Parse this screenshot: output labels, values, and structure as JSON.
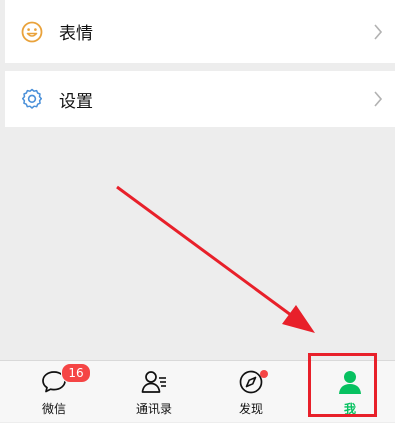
{
  "menu": {
    "items": [
      {
        "label": "表情",
        "icon": "smiley-icon"
      },
      {
        "label": "设置",
        "icon": "gear-icon"
      }
    ]
  },
  "tabbar": {
    "tabs": [
      {
        "label": "微信",
        "icon": "chat-bubble-icon",
        "badge": "16"
      },
      {
        "label": "通讯录",
        "icon": "contacts-icon"
      },
      {
        "label": "发现",
        "icon": "compass-icon",
        "dot": true
      },
      {
        "label": "我",
        "icon": "person-icon",
        "active": true
      }
    ]
  },
  "colors": {
    "accent": "#07c160",
    "icon_orange": "#e9a23b",
    "icon_blue": "#4a90d9",
    "badge": "#f54545",
    "annotation": "#e8202a"
  }
}
